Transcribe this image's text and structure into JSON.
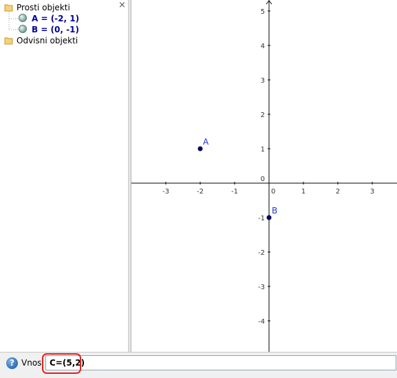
{
  "algebra": {
    "close_glyph": "×",
    "folders": [
      {
        "label": "Prosti objekti",
        "items": [
          {
            "label": "A = (-2, 1)"
          },
          {
            "label": "B = (0, -1)"
          }
        ]
      },
      {
        "label": "Odvisni objekti",
        "items": []
      }
    ]
  },
  "graphics": {
    "x_ticks": [
      "-3",
      "-2",
      "-1",
      "0",
      "1",
      "2",
      "3"
    ],
    "y_ticks": [
      "5",
      "4",
      "3",
      "2",
      "1",
      "-1",
      "-2",
      "-3",
      "-4"
    ],
    "origin_label": "0",
    "points": [
      {
        "name": "A",
        "x": -2,
        "y": 1
      },
      {
        "name": "B",
        "x": 0,
        "y": -1
      }
    ],
    "point_color": "#00007f",
    "label_color": "#2233cc"
  },
  "inputbar": {
    "help_glyph": "?",
    "label": "Vnos:",
    "value": "C=(5,2)",
    "highlight_color": "#e02020"
  }
}
